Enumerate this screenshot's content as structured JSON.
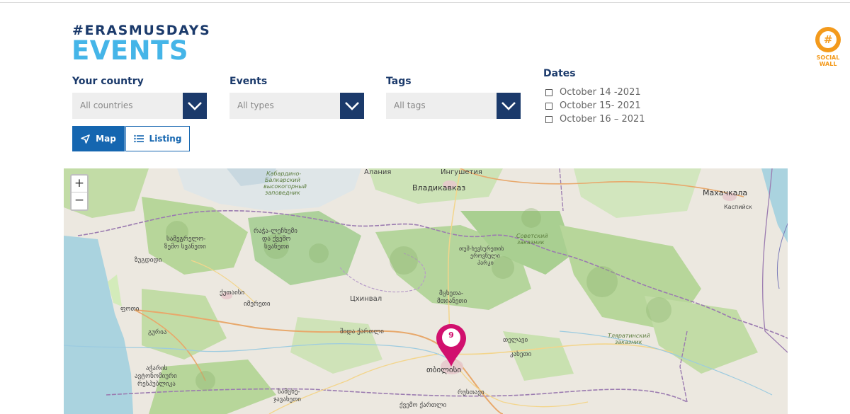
{
  "header": {
    "hashtag": "#ERASMUSDAYS",
    "title": "EVENTS"
  },
  "social_wall": {
    "label_line1": "SOCIAL",
    "label_line2": "WALL",
    "icon_glyph": "#",
    "color": "#f39a1c"
  },
  "filters": {
    "country": {
      "label": "Your country",
      "value": "All countries"
    },
    "events": {
      "label": "Events",
      "value": "All types"
    },
    "tags": {
      "label": "Tags",
      "value": "All tags"
    },
    "dates": {
      "label": "Dates",
      "options": [
        "October 14 -2021",
        "October 15- 2021",
        "October 16 – 2021"
      ]
    }
  },
  "view_toggle": {
    "map_label": "Map",
    "listing_label": "Listing",
    "active": "map"
  },
  "map": {
    "zoom_in": "+",
    "zoom_out": "−",
    "cluster_count": "9",
    "place_labels": {
      "alania": "Алания",
      "ingushetia": "Ингушетия",
      "vladikavkaz": "Владикавказ",
      "makhachkala": "Махачкала",
      "kaspiysk": "Каспийск",
      "kabardino1": "Кабардино-",
      "kabardino2": "Балкарский",
      "kabardino3": "высокогорный",
      "kabardino4": "заповедник",
      "sovetsky1": "Советский",
      "sovetsky2": "заказник",
      "tlyaratinsky1": "Тляратинский",
      "tlyaratinsky2": "заказник",
      "tskhinval": "Цхинвал",
      "samegrelo1": "სამეგრელო-",
      "samegrelo2": "ზემო სვანეთი",
      "racha1": "რაჭა-ლეჩხუმი",
      "racha2": "და ქვემო",
      "racha3": "სვანეთი",
      "zugdidi": "ზუგდიდი",
      "kutaisi": "ქუთაისი",
      "imereti": "იმერეთი",
      "poti": "ფოთი",
      "guria": "გურია",
      "shida": "შიდა ქართლი",
      "mtskheta1": "მცხეთა-",
      "mtskheta2": "მთიანეთი",
      "tusheti1": "თუშ-ხევსურეთის",
      "tusheti2": "ეროვნული",
      "tusheti3": "პარკი",
      "telavi": "თელავი",
      "kakheti": "კახეთი",
      "tbilisi": "თბილისი",
      "rustavi": "რუსთავი",
      "kvemo": "ქვემო ქართლი",
      "ajara1": "აჭარის",
      "ajara2": "ავტონომიური",
      "ajara3": "რესპუბლიკა",
      "samtskhe1": "სამცხე-",
      "samtskhe2": "ჯავახეთი"
    }
  }
}
